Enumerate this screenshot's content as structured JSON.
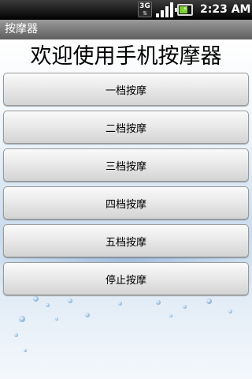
{
  "status_bar": {
    "network_label": "3G",
    "network_arrows": "⇅",
    "battery_bolt": "⚡",
    "battery_level": 0.7,
    "signal_bars": 4,
    "time": "2:23 AM",
    "icons": [
      "network-3g-icon",
      "signal-strength-icon",
      "battery-charging-icon"
    ]
  },
  "title_bar": {
    "title": "按摩器"
  },
  "main": {
    "heading": "欢迎使用手机按摩器",
    "buttons": [
      {
        "label": "一档按摩"
      },
      {
        "label": "二档按摩"
      },
      {
        "label": "三档按摩"
      },
      {
        "label": "四档按摩"
      },
      {
        "label": "五档按摩"
      },
      {
        "label": "停止按摩"
      }
    ]
  },
  "colors": {
    "status_bar_bg": "#000000",
    "title_bar_bg": "#7a7a7a",
    "battery_fill": "#7bd12f",
    "background_water": "#cfe0f0"
  }
}
